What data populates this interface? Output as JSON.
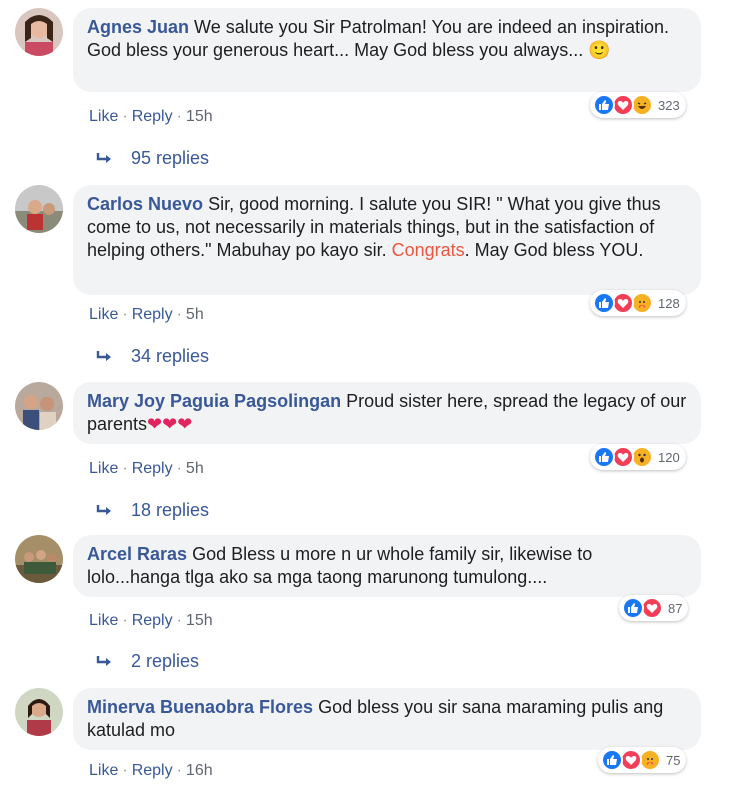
{
  "colors": {
    "name": "#385898",
    "bubble": "#f2f3f5",
    "like": "#1877f2",
    "love": "#f33e58",
    "haha": "#f7b125"
  },
  "comments": [
    {
      "author": "Agnes Juan",
      "text": "We salute you Sir Patrolman! You are indeed an inspiration. God bless your generous heart... May God bless you always...",
      "emoji": "🙂",
      "reactions": [
        "like-icon",
        "love-icon",
        "haha-icon"
      ],
      "count": "323",
      "like": "Like",
      "reply": "Reply",
      "time": "15h",
      "replies": "95 replies"
    },
    {
      "author": "Carlos Nuevo",
      "text_before": "Sir, good morning. I salute you SIR! \" What you give thus come to us, not necessarily in materials things, but in the satisfaction of helping others.\" Mabuhay po kayo sir.",
      "highlight": "Congrats",
      "text_after": ". May God bless YOU.",
      "reactions": [
        "like-icon",
        "love-icon",
        "care-icon"
      ],
      "count": "128",
      "like": "Like",
      "reply": "Reply",
      "time": "5h",
      "replies": "34 replies"
    },
    {
      "author": "Mary Joy Paguia Pagsolingan",
      "text": "Proud sister here, spread the legacy of our parents",
      "emoji": "❤❤❤",
      "reactions": [
        "like-icon",
        "love-icon",
        "wow-icon"
      ],
      "count": "120",
      "like": "Like",
      "reply": "Reply",
      "time": "5h",
      "replies": "18 replies"
    },
    {
      "author": "Arcel Raras",
      "text": "God Bless u more n ur whole family sir, likewise to lolo...hanga tlga ako sa mga taong marunong tumulong....",
      "reactions": [
        "like-icon",
        "love-icon"
      ],
      "count": "87",
      "like": "Like",
      "reply": "Reply",
      "time": "15h",
      "replies": "2 replies"
    },
    {
      "author": "Minerva Buenaobra Flores",
      "text": "God bless you sir sana maraming pulis ang katulad mo",
      "reactions": [
        "like-icon",
        "love-icon",
        "care-icon"
      ],
      "count": "75",
      "like": "Like",
      "reply": "Reply",
      "time": "16h"
    }
  ]
}
